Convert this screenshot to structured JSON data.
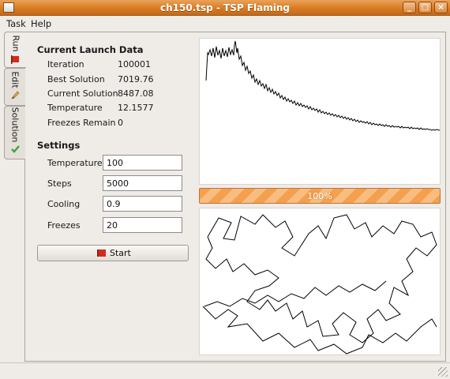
{
  "window": {
    "title": "ch150.tsp - TSP Flaming"
  },
  "menu": {
    "task": "Task",
    "help": "Help"
  },
  "tabs": [
    {
      "label": "Run",
      "icon": "red-flag-icon",
      "active": true
    },
    {
      "label": "Edit",
      "icon": "pencil-icon"
    },
    {
      "label": "Solution",
      "icon": "green-check-icon"
    }
  ],
  "launch": {
    "heading": "Current Launch Data",
    "rows": [
      {
        "label": "Iteration",
        "value": "100001"
      },
      {
        "label": "Best Solution",
        "value": "7019.76"
      },
      {
        "label": "Current Solution",
        "value": "8487.08"
      },
      {
        "label": "Temperature",
        "value": "12.1577"
      },
      {
        "label": "Freezes Remain",
        "value": "0"
      }
    ]
  },
  "settings": {
    "heading": "Settings",
    "fields": [
      {
        "label": "Temperature",
        "value": "100"
      },
      {
        "label": "Steps",
        "value": "5000"
      },
      {
        "label": "Cooling",
        "value": "0.9"
      },
      {
        "label": "Freezes",
        "value": "20"
      }
    ],
    "start_label": "Start"
  },
  "progress": {
    "percent": 100,
    "text": "100%"
  },
  "colors": {
    "titlebar": "#d97a23",
    "progress": "#f4a04e",
    "flag": "#d42a1f",
    "check": "#3aa33a"
  }
}
